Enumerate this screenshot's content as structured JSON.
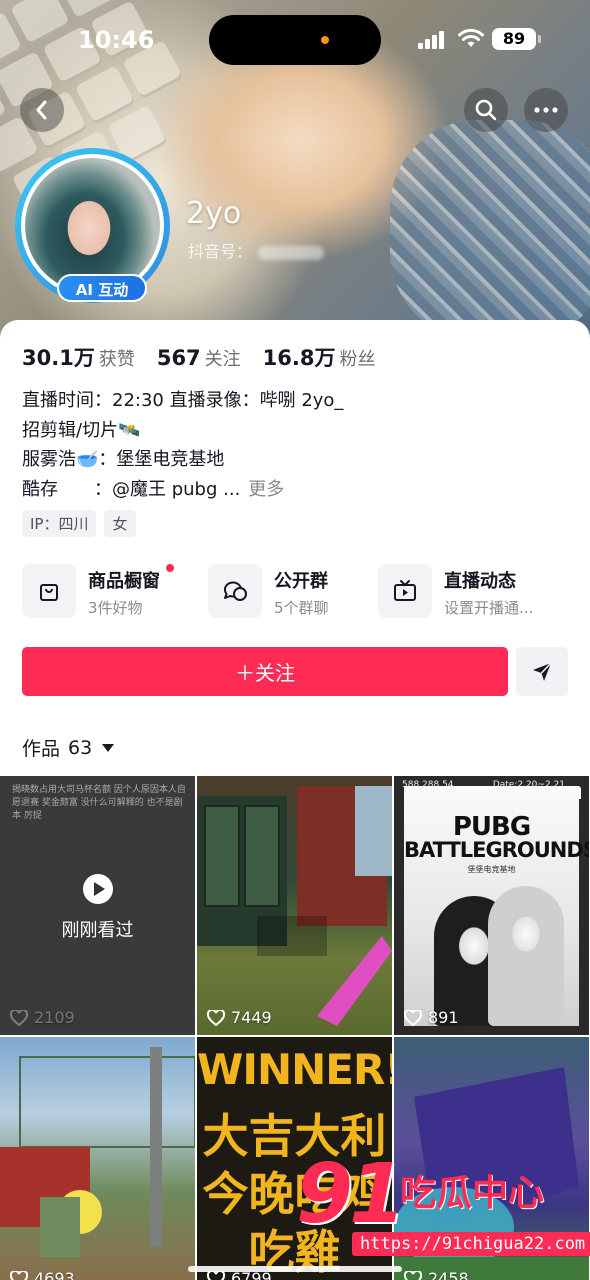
{
  "status_bar": {
    "time": "10:46",
    "battery": "89"
  },
  "profile": {
    "nickname": "2yo",
    "douyin_id_label": "抖音号：",
    "ai_badge": "AI 互动"
  },
  "stats": [
    {
      "value": "30.1万",
      "label": "获赞"
    },
    {
      "value": "567",
      "label": "关注"
    },
    {
      "value": "16.8万",
      "label": "粉丝"
    }
  ],
  "bio": {
    "line1": "直播时间：22:30 直播录像：哔哵 2yo_",
    "line2": "招剪辑/切片🛰️",
    "line3": "服雾浩🥣：堡堡电竞基地",
    "line4": "酷存　　：@魔王 pubg ...",
    "more": "更多"
  },
  "tags": [
    "IP：四川",
    "女"
  ],
  "shortcuts": [
    {
      "title": "商品橱窗",
      "subtitle": "3件好物",
      "icon": "shopping-bag-icon"
    },
    {
      "title": "公开群",
      "subtitle": "5个群聊",
      "icon": "chat-bubbles-icon"
    },
    {
      "title": "直播动态",
      "subtitle": "设置开播通...",
      "icon": "tv-icon"
    }
  ],
  "actions": {
    "follow_label": "＋关注"
  },
  "works": {
    "label": "作品",
    "count": "63"
  },
  "grid": {
    "t1_text": "揭晓数占用大司马杯名额 因个人原因本人自愿退赛 奖金颇富 没什么可解释的 也不是剧本 厉捉",
    "watched_label": "刚刚看过",
    "t3_top": "588 288 54",
    "t3_date": "Date:2.20~2.21",
    "t3_pubg": "PUBG",
    "t3_battle": "BATTLEGROUNDS",
    "t3_sub": "堡堡电竞基地",
    "winner": "WINNER!",
    "cjk_line1": "大吉大利",
    "cjk_line2": "今晚吃鸡",
    "cjk_line3": "吃雞",
    "likes": [
      "2109",
      "7449",
      "891",
      "4693",
      "6799",
      "2458"
    ]
  },
  "watermark": {
    "brand_num": "91",
    "brand_cn": "吃瓜中心",
    "url": "https://91chigua22.com"
  },
  "colors": {
    "accent": "#fe2c55",
    "ai_badge": "#1d6fe0",
    "ring": "#3ec9f2"
  }
}
